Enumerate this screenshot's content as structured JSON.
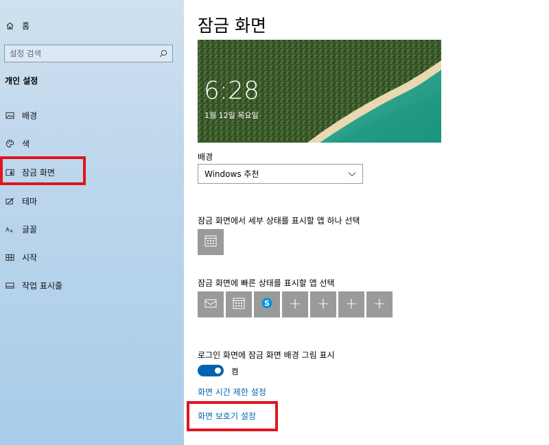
{
  "sidebar": {
    "home": {
      "label": "홈",
      "icon": "home-icon"
    },
    "search": {
      "placeholder": "설정 검색",
      "icon": "search-icon"
    },
    "section_title": "개인 설정",
    "items": [
      {
        "label": "배경",
        "icon": "picture-icon"
      },
      {
        "label": "색",
        "icon": "palette-icon"
      },
      {
        "label": "잠금 화면",
        "icon": "lock-screen-icon",
        "selected": true
      },
      {
        "label": "테마",
        "icon": "theme-brush-icon"
      },
      {
        "label": "글꼴",
        "icon": "font-icon"
      },
      {
        "label": "시작",
        "icon": "start-grid-icon"
      },
      {
        "label": "작업 표시줄",
        "icon": "taskbar-icon"
      }
    ]
  },
  "main": {
    "title": "잠금 화면",
    "preview": {
      "time": "6:28",
      "date": "1월 12일 목요일"
    },
    "background_label": "배경",
    "background_value": "Windows 추천",
    "detailed_status_label": "잠금 화면에서 세부 상태를 표시할 앱 하나 선택",
    "quick_status_label": "잠금 화면에 빠른 상태를 표시할 앱 선택",
    "quick_apps": [
      "mail-icon",
      "calendar-icon",
      "skype-icon",
      "+",
      "+",
      "+",
      "+"
    ],
    "signin_label": "로그인 화면에 잠금 화면 배경 그림 표시",
    "toggle_state": "켬",
    "links": {
      "timeout": "화면 시간 제한 설정",
      "screensaver": "화면 보호기 설정"
    }
  },
  "colors": {
    "accent": "#0063b1",
    "highlight": "#e0141e",
    "tile": "#9a9a9a"
  }
}
